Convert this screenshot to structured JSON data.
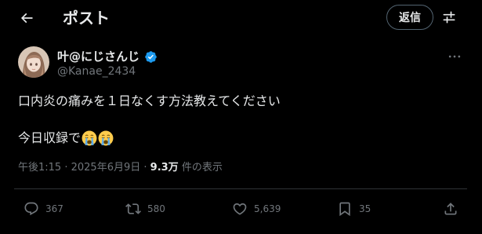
{
  "header": {
    "title": "ポスト",
    "reply_label": "返信"
  },
  "tweet": {
    "display_name": "叶@にじさんじ",
    "handle": "@Kanae_2434",
    "text_line1": "口内炎の痛みを１日なくす方法教えてください",
    "text_line2": "今日収録で",
    "time": "午後1:15",
    "sep1": " · ",
    "date": "2025年6月9日",
    "sep2": " · ",
    "views_count": "9.3万",
    "views_label": " 件の表示"
  },
  "actions": {
    "replies": "367",
    "reposts": "580",
    "likes": "5,639",
    "bookmarks": "35"
  },
  "colors": {
    "background": "#000000",
    "text_primary": "#e7e9ea",
    "text_secondary": "#71767b",
    "border": "#2f3336",
    "verified": "#1d9bf0"
  },
  "icons": [
    "back-arrow-icon",
    "options-sliders-icon",
    "verified-badge-icon",
    "more-dots-icon",
    "crying-face-emoji",
    "reply-icon",
    "repost-icon",
    "like-heart-icon",
    "bookmark-icon",
    "share-icon"
  ]
}
